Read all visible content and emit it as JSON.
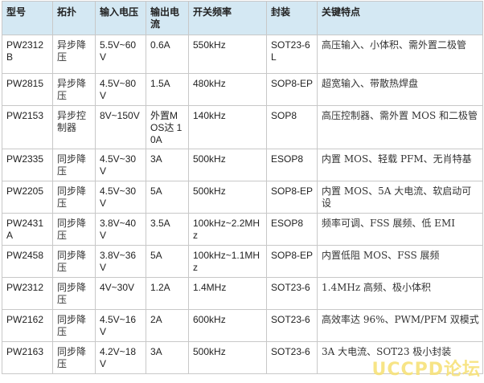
{
  "table": {
    "headers": [
      "型号",
      "拓扑",
      "输入电压",
      "输出电流",
      "开关频率",
      "封装",
      "关键特点"
    ],
    "rows": [
      [
        "PW2312B",
        "异步降压",
        "5.5V~60V",
        "0.6A",
        "550kHz",
        "SOT23-6L",
        "高压输入、小体积、需外置二极管"
      ],
      [
        "PW2815",
        "异步降压",
        "4.5V~80V",
        "1.5A",
        "480kHz",
        "SOP8-EP",
        "超宽输入、带散热焊盘"
      ],
      [
        "PW2153",
        "异步控制器",
        "8V~150V",
        "外置MOS达 10A",
        "140kHz",
        "SOP8",
        "高压控制器、需外置 MOS 和二极管"
      ],
      [
        "PW2335",
        "同步降压",
        "4.5V~30V",
        "3A",
        "500kHz",
        "ESOP8",
        "内置 MOS、轻载 PFM、无肖特基"
      ],
      [
        "PW2205",
        "同步降压",
        "4.5V~30V",
        "5A",
        "500kHz",
        "SOP8-EP",
        "内置 MOS、5A 大电流、软启动可设"
      ],
      [
        "PW2431A",
        "同步降压",
        "3.8V~40V",
        "3.5A",
        "100kHz~2.2MHz",
        "ESOP8",
        "频率可调、FSS 展频、低 EMI"
      ],
      [
        "PW2458",
        "同步降压",
        "3.8V~36V",
        "5A",
        "100kHz~1.1MHz",
        "SOP8-EP",
        "内置低阻 MOS、FSS 展频"
      ],
      [
        "PW2312",
        "同步降压",
        "4V~30V",
        "1.2A",
        "1.4MHz",
        "SOT23-6",
        "1.4MHz 高频、极小体积"
      ],
      [
        "PW2162",
        "同步降压",
        "4.5V~16V",
        "2A",
        "600kHz",
        "SOT23-6",
        "高效率达 96%、PWM/PFM 双模式"
      ],
      [
        "PW2163",
        "同步降压",
        "4.2V~18V",
        "3A",
        "500kHz",
        "SOT23-6",
        "3A 大电流、SOT23 极小封装"
      ]
    ]
  },
  "watermark": "UCCPD论坛"
}
